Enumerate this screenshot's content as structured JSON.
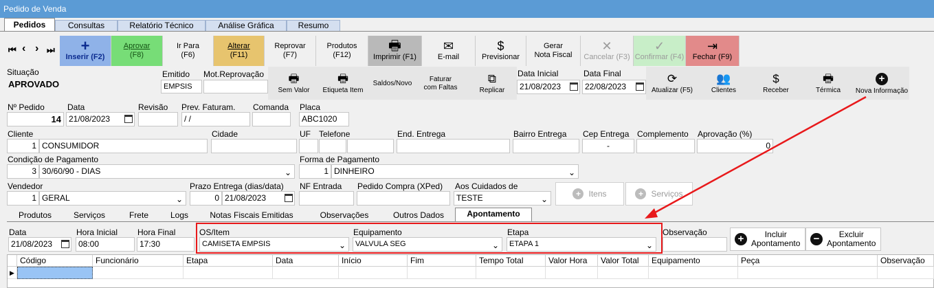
{
  "window_title": "Pedido de Venda",
  "tabs": [
    "Pedidos",
    "Consultas",
    "Relatório Técnico",
    "Análise Gráfica",
    "Resumo"
  ],
  "nav": [
    "⏮",
    "‹",
    "›",
    "⏭"
  ],
  "toolbar": [
    {
      "line1": "Inserir (F2)",
      "line2": "",
      "icon": "+"
    },
    {
      "line1": "Aprovar",
      "line2": "(F8)"
    },
    {
      "line1": "Ir Para",
      "line2": "(F6)"
    },
    {
      "line1": "Alterar",
      "line2": "(F11)"
    },
    {
      "line1": "Reprovar",
      "line2": "(F7)"
    },
    {
      "line1": "Produtos",
      "line2": "(F12)"
    },
    {
      "line1": "Imprimir (F1)",
      "line2": "",
      "icon": "🖶"
    },
    {
      "line1": "E-mail",
      "line2": "",
      "icon": "✉"
    },
    {
      "line1": "Previsionar",
      "line2": "",
      "icon": "$"
    },
    {
      "line1": "Gerar",
      "line2": "Nota Fiscal"
    },
    {
      "line1": "Cancelar (F3)",
      "line2": "",
      "icon": "✕"
    },
    {
      "line1": "Confirmar (F4)",
      "line2": "",
      "icon": "✓"
    },
    {
      "line1": "Fechar (F9)",
      "line2": "",
      "icon": "⇥"
    }
  ],
  "status": {
    "situacao_label": "Situação",
    "situacao_value": "APROVADO",
    "emitido_label": "Emitido",
    "emitido_value": "EMPSIS",
    "motrep_label": "Mot.Reprovação",
    "motrep_value": ""
  },
  "actions": [
    {
      "label": "Sem Valor",
      "icon": "🖶"
    },
    {
      "label": "Etiqueta Item",
      "icon": "🖶"
    },
    {
      "label": "Saldos/Novo"
    },
    {
      "label": "Faturar com Faltas"
    },
    {
      "label": "Replicar",
      "icon": "⧉"
    },
    {
      "label": "Atualizar (F5)",
      "icon": "⟳"
    },
    {
      "label": "Clientes",
      "icon": "👥"
    },
    {
      "label": "Receber",
      "icon": "$"
    },
    {
      "label": "Térmica",
      "icon": "🖶"
    },
    {
      "label": "Nova Informação",
      "icon": "+"
    }
  ],
  "faturar_line1": "Faturar",
  "faturar_line2": "com Faltas",
  "dates": {
    "inicial_label": "Data Inicial",
    "inicial_value": "21/08/2023",
    "final_label": "Data Final",
    "final_value": "22/08/2023"
  },
  "pedido": {
    "num_label": "Nº Pedido",
    "num_value": "14",
    "data_label": "Data",
    "data_value": "21/08/2023",
    "revisao_label": "Revisão",
    "revisao_value": "",
    "prev_label": "Prev. Faturam.",
    "prev_value": " /  /",
    "comanda_label": "Comanda",
    "comanda_value": "",
    "placa_label": "Placa",
    "placa_value": "ABC1020"
  },
  "cliente": {
    "label": "Cliente",
    "code": "1",
    "name": "CONSUMIDOR",
    "cidade_label": "Cidade",
    "uf_label": "UF",
    "telefone_label": "Telefone",
    "end_label": "End. Entrega",
    "bairro_label": "Bairro Entrega",
    "cep_label": "Cep Entrega",
    "cep_value": "-",
    "complemento_label": "Complemento",
    "aprovacao_label": "Aprovação (%)",
    "aprovacao_value": "0"
  },
  "pagamento": {
    "cond_label": "Condição de Pagamento",
    "cond_code": "3",
    "cond_value": "30/60/90 - DIAS",
    "forma_label": "Forma de Pagamento",
    "forma_code": "1",
    "forma_value": "DINHEIRO"
  },
  "vendedor": {
    "label": "Vendedor",
    "code": "1",
    "name": "GERAL",
    "prazo_label": "Prazo Entrega (dias/data)",
    "prazo_days": "0",
    "prazo_date": "21/08/2023",
    "nf_label": "NF Entrada",
    "pedcompra_label": "Pedido Compra (XPed)",
    "cuidados_label": "Aos Cuidados de",
    "cuidados_value": "TESTE",
    "itens_btn": "Itens",
    "servicos_btn": "Serviços"
  },
  "subtabs": [
    "Produtos",
    "Serviços",
    "Frete",
    "Logs",
    "Notas Fiscais Emitidas",
    "Observações",
    "Outros Dados",
    "Apontamento"
  ],
  "apontamento": {
    "data_label": "Data",
    "data_value": "21/08/2023",
    "hini_label": "Hora Inicial",
    "hini_value": "08:00",
    "hfim_label": "Hora Final",
    "hfim_value": "17:30",
    "os_label": "OS/Item",
    "os_value": "CAMISETA EMPSIS",
    "equip_label": "Equipamento",
    "equip_value": "VALVULA SEG",
    "etapa_label": "Etapa",
    "etapa_value": "ETAPA 1",
    "obs_label": "Observação",
    "incluir_line1": "Incluir",
    "incluir_line2": "Apontamento",
    "excluir_line1": "Excluir",
    "excluir_line2": "Apontamento"
  },
  "grid_columns": [
    "Código",
    "Funcionário",
    "Etapa",
    "Data",
    "Início",
    "Fim",
    "Tempo Total",
    "Valor Hora",
    "Valor Total",
    "Equipamento",
    "Peça",
    "Observação"
  ],
  "colors": {
    "accent": "#5b9bd5",
    "highlight_red": "#e8191b",
    "approve": "#77dd77",
    "alter": "#e7c46e",
    "close": "#e28a8a",
    "insert": "#8fb2e8"
  }
}
